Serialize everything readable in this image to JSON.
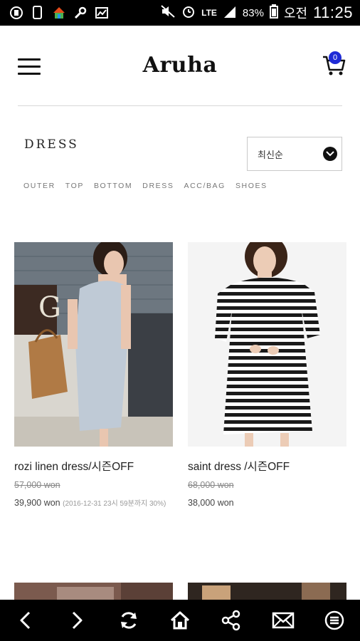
{
  "status_bar": {
    "network": "LTE",
    "battery": "83%",
    "ampm": "오전",
    "time": "11:25"
  },
  "header": {
    "logo": "Aruha",
    "cart_count": "0"
  },
  "category": {
    "title": "DRESS",
    "sort_selected": "최신순",
    "nav": [
      "OUTER",
      "TOP",
      "BOTTOM",
      "DRESS",
      "ACC/BAG",
      "SHOES"
    ]
  },
  "products": [
    {
      "name": "rozi linen dress/시즌OFF",
      "original_price": "57,000 won",
      "sale_price": "39,900 won",
      "note": "(2016-12-31 23시 59분까지 30%)"
    },
    {
      "name": "saint dress /시즌OFF",
      "original_price": "68,000 won",
      "sale_price": "38,000 won"
    }
  ],
  "colors": {
    "accent_badge": "#1f2bd6",
    "bars": "#000000"
  },
  "icons": [
    "menu-icon",
    "cart-icon",
    "chevron-down-icon",
    "back-icon",
    "forward-icon",
    "refresh-icon",
    "home-icon",
    "share-icon",
    "mail-icon",
    "menu-circle-icon"
  ]
}
